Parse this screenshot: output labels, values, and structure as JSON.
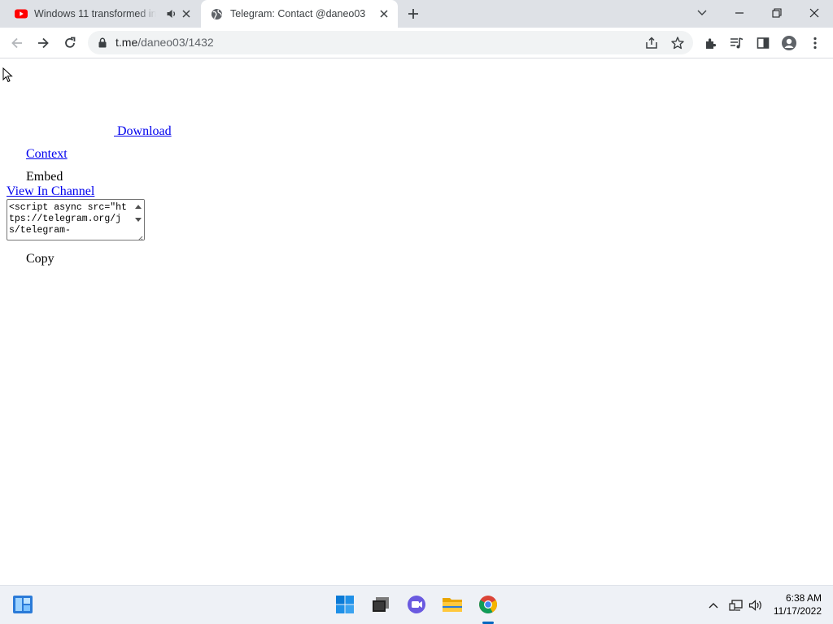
{
  "tabs": [
    {
      "title": "Windows 11 transformed into",
      "favicon": "youtube-icon",
      "muted_icon": "speaker-icon"
    },
    {
      "title": "Telegram: Contact @daneo03",
      "favicon": "globe-icon"
    }
  ],
  "address_bar": {
    "host": "t.me",
    "path": "/daneo03/1432"
  },
  "page": {
    "download_link": "Download",
    "context_link": "Context",
    "embed_label": "Embed",
    "view_in_channel_link": "View In Channel",
    "embed_code": "<script async src=\"https://telegram.org/js/telegram-",
    "copy_label": "Copy"
  },
  "taskbar": {
    "time": "6:38 AM",
    "date": "11/17/2022",
    "pinned": [
      "start-icon",
      "file-explorer-icon",
      "chat-icon",
      "folder-icon",
      "chrome-icon"
    ]
  },
  "colors": {
    "tab_strip": "#dee1e6",
    "link": "#0000ee",
    "accent": "#0067c0"
  }
}
